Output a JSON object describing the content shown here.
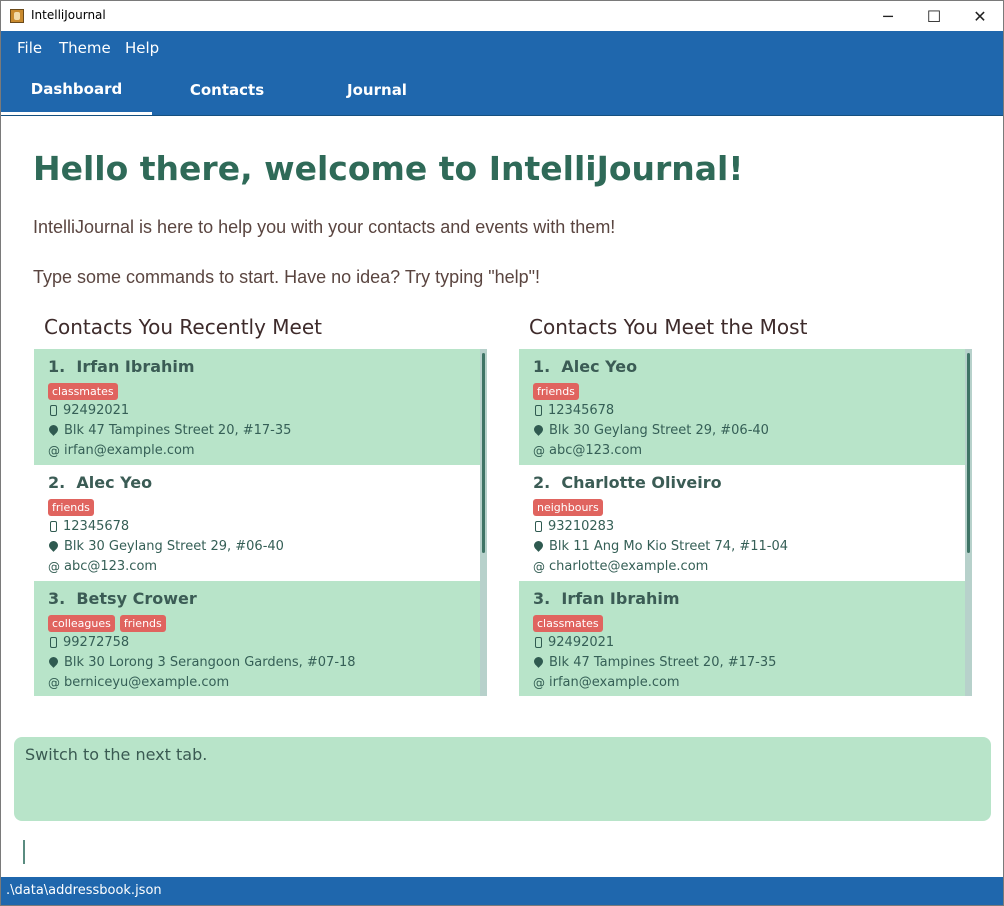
{
  "window": {
    "title": "IntelliJournal",
    "minimize": "─",
    "maximize": "☐",
    "close": "✕"
  },
  "menu": {
    "items": [
      "File",
      "Theme",
      "Help"
    ]
  },
  "tabs": [
    {
      "label": "Dashboard",
      "active": true
    },
    {
      "label": "Contacts",
      "active": false
    },
    {
      "label": "Journal",
      "active": false
    }
  ],
  "welcome": {
    "heading": "Hello there, welcome to IntelliJournal!",
    "line1": "IntelliJournal is here to help you with your contacts and events with them!",
    "line2": "Type some commands to start. Have no idea? Try typing \"help\"!"
  },
  "recent": {
    "title": "Contacts You Recently Meet",
    "contacts": [
      {
        "index": "1.",
        "name": "Irfan Ibrahim",
        "tags": [
          "classmates"
        ],
        "phone": "92492021",
        "address": "Blk 47 Tampines Street 20, #17-35",
        "email": "irfan@example.com"
      },
      {
        "index": "2.",
        "name": "Alec Yeo",
        "tags": [
          "friends"
        ],
        "phone": "12345678",
        "address": "Blk 30 Geylang Street 29, #06-40",
        "email": "abc@123.com"
      },
      {
        "index": "3.",
        "name": "Betsy Crower",
        "tags": [
          "colleagues",
          "friends"
        ],
        "phone": "99272758",
        "address": "Blk 30 Lorong 3 Serangoon Gardens, #07-18",
        "email": "berniceyu@example.com"
      }
    ]
  },
  "most": {
    "title": "Contacts You Meet the Most",
    "contacts": [
      {
        "index": "1.",
        "name": "Alec Yeo",
        "tags": [
          "friends"
        ],
        "phone": "12345678",
        "address": "Blk 30 Geylang Street 29, #06-40",
        "email": "abc@123.com"
      },
      {
        "index": "2.",
        "name": "Charlotte Oliveiro",
        "tags": [
          "neighbours"
        ],
        "phone": "93210283",
        "address": "Blk 11 Ang Mo Kio Street 74, #11-04",
        "email": "charlotte@example.com"
      },
      {
        "index": "3.",
        "name": "Irfan Ibrahim",
        "tags": [
          "classmates"
        ],
        "phone": "92492021",
        "address": "Blk 47 Tampines Street 20, #17-35",
        "email": "irfan@example.com"
      }
    ]
  },
  "result": {
    "text": "Switch to the next tab."
  },
  "command": {
    "value": ""
  },
  "status": {
    "path": ".\\data\\addressbook.json"
  },
  "colors": {
    "primary": "#1f67ad",
    "card_green": "#b8e4c9",
    "tag_red": "#e0645f",
    "heading": "#2f6a58"
  }
}
